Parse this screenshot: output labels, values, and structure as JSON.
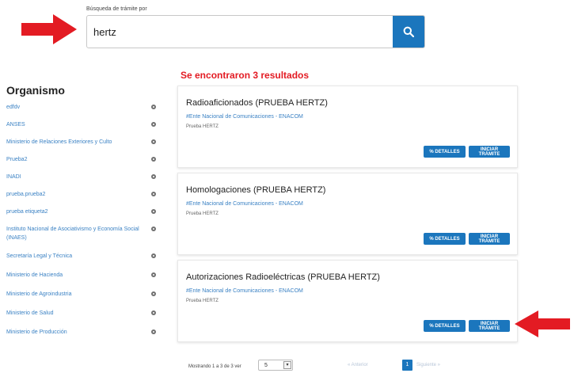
{
  "search": {
    "label": "Búsqueda de trámite por",
    "value": "hertz"
  },
  "sidebar": {
    "title": "Organismo",
    "items": [
      {
        "label": "edfdv"
      },
      {
        "label": "ANSES"
      },
      {
        "label": "Ministerio de Relaciones Exteriores y Culto"
      },
      {
        "label": "Prueba2"
      },
      {
        "label": "INADI"
      },
      {
        "label": "prueba.prueba2"
      },
      {
        "label": "prueba etiqueta2"
      },
      {
        "label": "Instituto Nacional de Asociativismo y Economía Social (INAES)"
      },
      {
        "label": "Secretaría Legal y Técnica"
      },
      {
        "label": "Ministerio de Hacienda"
      },
      {
        "label": "Ministerio de Agroindustria"
      },
      {
        "label": "Ministerio de Salud"
      },
      {
        "label": "Ministerio de Producción"
      }
    ]
  },
  "results": {
    "heading": "Se encontraron 3 resultados",
    "cards": [
      {
        "title": "Radioaficionados (PRUEBA HERTZ)",
        "org": "#Ente Nacional de Comunicaciones - ENACOM",
        "desc": "Prueba HERTZ",
        "details_label": "DETALLES",
        "start_label": "INICIAR TRÁMITE"
      },
      {
        "title": "Homologaciones (PRUEBA HERTZ)",
        "org": "#Ente Nacional de Comunicaciones - ENACOM",
        "desc": "Prueba HERTZ",
        "details_label": "DETALLES",
        "start_label": "INICIAR TRÁMITE"
      },
      {
        "title": "Autorizaciones Radioeléctricas (PRUEBA HERTZ)",
        "org": "#Ente Nacional de Comunicaciones - ENACOM",
        "desc": "Prueba HERTZ",
        "details_label": "DETALLES",
        "start_label": "INICIAR TRÁMITE"
      }
    ]
  },
  "pagination": {
    "showing_text": "Mostrando 1 a 3 de 3 ver",
    "page_size": "5",
    "prev_label": "« Anterior",
    "current_page": "1",
    "next_label": "Siguiente »"
  },
  "colors": {
    "accent": "#1b76bd",
    "alert": "#e31b23",
    "link": "#3b82c4"
  },
  "icons": [
    "search-icon",
    "arrow-right-icon",
    "arrow-left-icon",
    "info-dot-icon",
    "caret-down-icon"
  ]
}
